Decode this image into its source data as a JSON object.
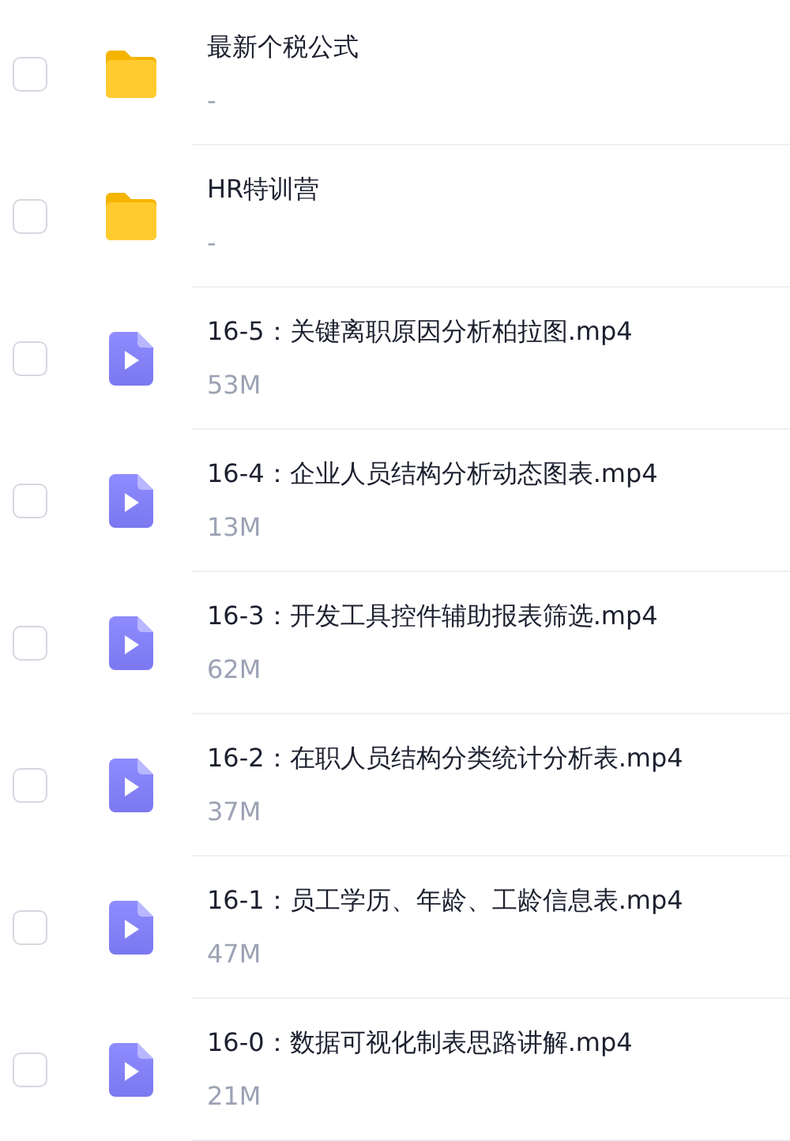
{
  "files": [
    {
      "kind": "folder",
      "name": "最新个税公式",
      "size": "-",
      "selected": false
    },
    {
      "kind": "folder",
      "name": "HR特训营",
      "size": "-",
      "selected": false
    },
    {
      "kind": "video",
      "name": "16-5：关键离职原因分析柏拉图.mp4",
      "size": "53M",
      "selected": false
    },
    {
      "kind": "video",
      "name": "16-4：企业人员结构分析动态图表.mp4",
      "size": "13M",
      "selected": false
    },
    {
      "kind": "video",
      "name": "16-3：开发工具控件辅助报表筛选.mp4",
      "size": "62M",
      "selected": false
    },
    {
      "kind": "video",
      "name": "16-2：在职人员结构分类统计分析表.mp4",
      "size": "37M",
      "selected": false
    },
    {
      "kind": "video",
      "name": "16-1：员工学历、年龄、工龄信息表.mp4",
      "size": "47M",
      "selected": false
    },
    {
      "kind": "video",
      "name": "16-0：数据可视化制表思路讲解.mp4",
      "size": "21M",
      "selected": false
    }
  ]
}
